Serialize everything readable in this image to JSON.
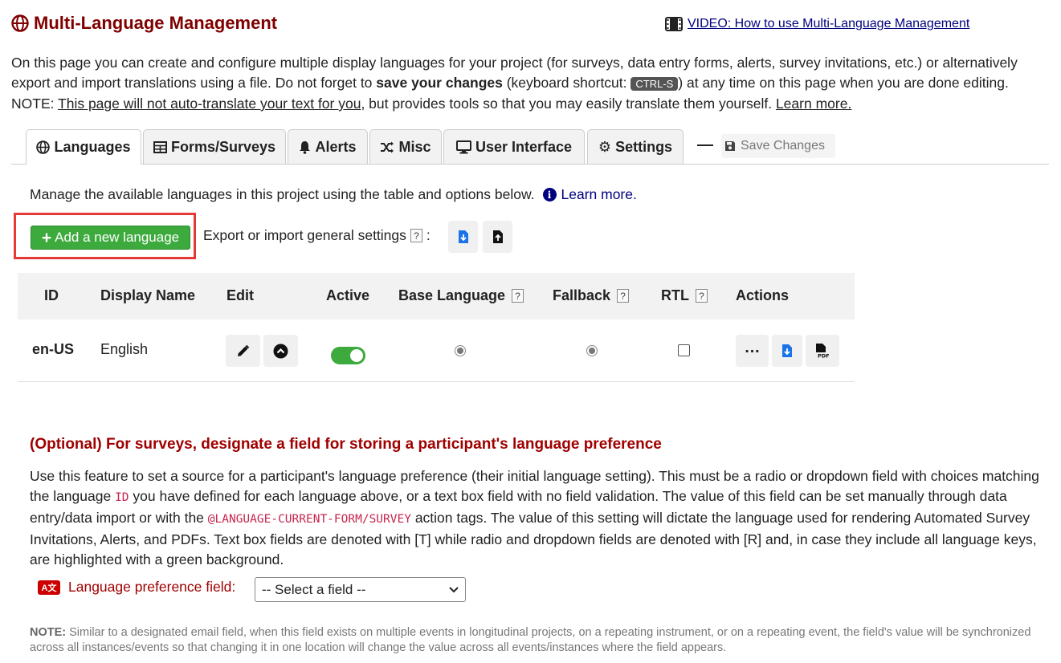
{
  "header": {
    "title": "Multi-Language Management",
    "video_link": "VIDEO: How to use Multi-Language Management"
  },
  "intro": {
    "part1": "On this page you can create and configure multiple display languages for your project (for surveys, data entry forms, alerts, survey invitations, etc.) or alternatively export and import translations using a file. Do not forget to ",
    "bold": "save your changes",
    "part2": " (keyboard shortcut: ",
    "shortcut": "CTRL-S",
    "part3": ") at any time on this page when you are done editing. NOTE: ",
    "underline": "This page will not auto-translate your text for you",
    "part4": ", but provides tools so that you may easily translate them yourself. ",
    "learn_more": "Learn more."
  },
  "tabs": [
    {
      "label": "Languages",
      "icon": "globe-icon",
      "active": true
    },
    {
      "label": "Forms/Surveys",
      "icon": "table-icon",
      "active": false
    },
    {
      "label": "Alerts",
      "icon": "bell-icon",
      "active": false
    },
    {
      "label": "Misc",
      "icon": "shuffle-icon",
      "active": false
    },
    {
      "label": "User Interface",
      "icon": "monitor-icon",
      "active": false
    },
    {
      "label": "Settings",
      "icon": "gear-icon",
      "active": false
    }
  ],
  "save_changes": "Save Changes",
  "languages": {
    "manage_text": "Manage the available languages in this project using the table and options below.",
    "learn_more": "Learn more.",
    "add_button": "Add a new language",
    "export_text": "Export or import general settings",
    "export_colon": ":"
  },
  "help_marker": "?",
  "table": {
    "headers": [
      "ID",
      "Display Name",
      "Edit",
      "Active",
      "Base Language",
      "Fallback",
      "RTL",
      "Actions"
    ],
    "rows": [
      {
        "id": "en-US",
        "display_name": "English",
        "active": true,
        "base_language": true,
        "fallback": true,
        "rtl": false
      }
    ]
  },
  "optional": {
    "heading": "(Optional) For surveys, designate a field for storing a participant's language preference",
    "p1": "Use this feature to set a source for a participant's language preference (their initial language setting). This must be a radio or dropdown field with choices matching the language ",
    "code1": "ID",
    "p2": " you have defined for each language above, or a text box field with no field validation. The value of this field can be set manually through data entry/data import or with the ",
    "code2": "@LANGUAGE-CURRENT-FORM/SURVEY",
    "p3": " action tags. The value of this setting will dictate the language used for rendering Automated Survey Invitations, Alerts, and PDFs. Text box fields are denoted with [T] while radio and dropdown fields are denoted with [R] and, in case they include all language keys, are highlighted with a green background.",
    "pref_label": "Language preference field:",
    "select_value": "-- Select a field --",
    "note_bold": "NOTE:",
    "note_text": " Similar to a designated email field, when this field exists on multiple events in longitudinal projects, on a repeating instrument, or on a repeating event, the field's value will be synchronized across all instances/events so that changing it in one location will change the value across all events/instances where the field appears."
  },
  "colors": {
    "title": "#800000",
    "add_button": "#3daa3d",
    "highlight_box": "#e53935",
    "link": "#000080",
    "optional_heading": "#a00000",
    "code": "#c7254e"
  }
}
